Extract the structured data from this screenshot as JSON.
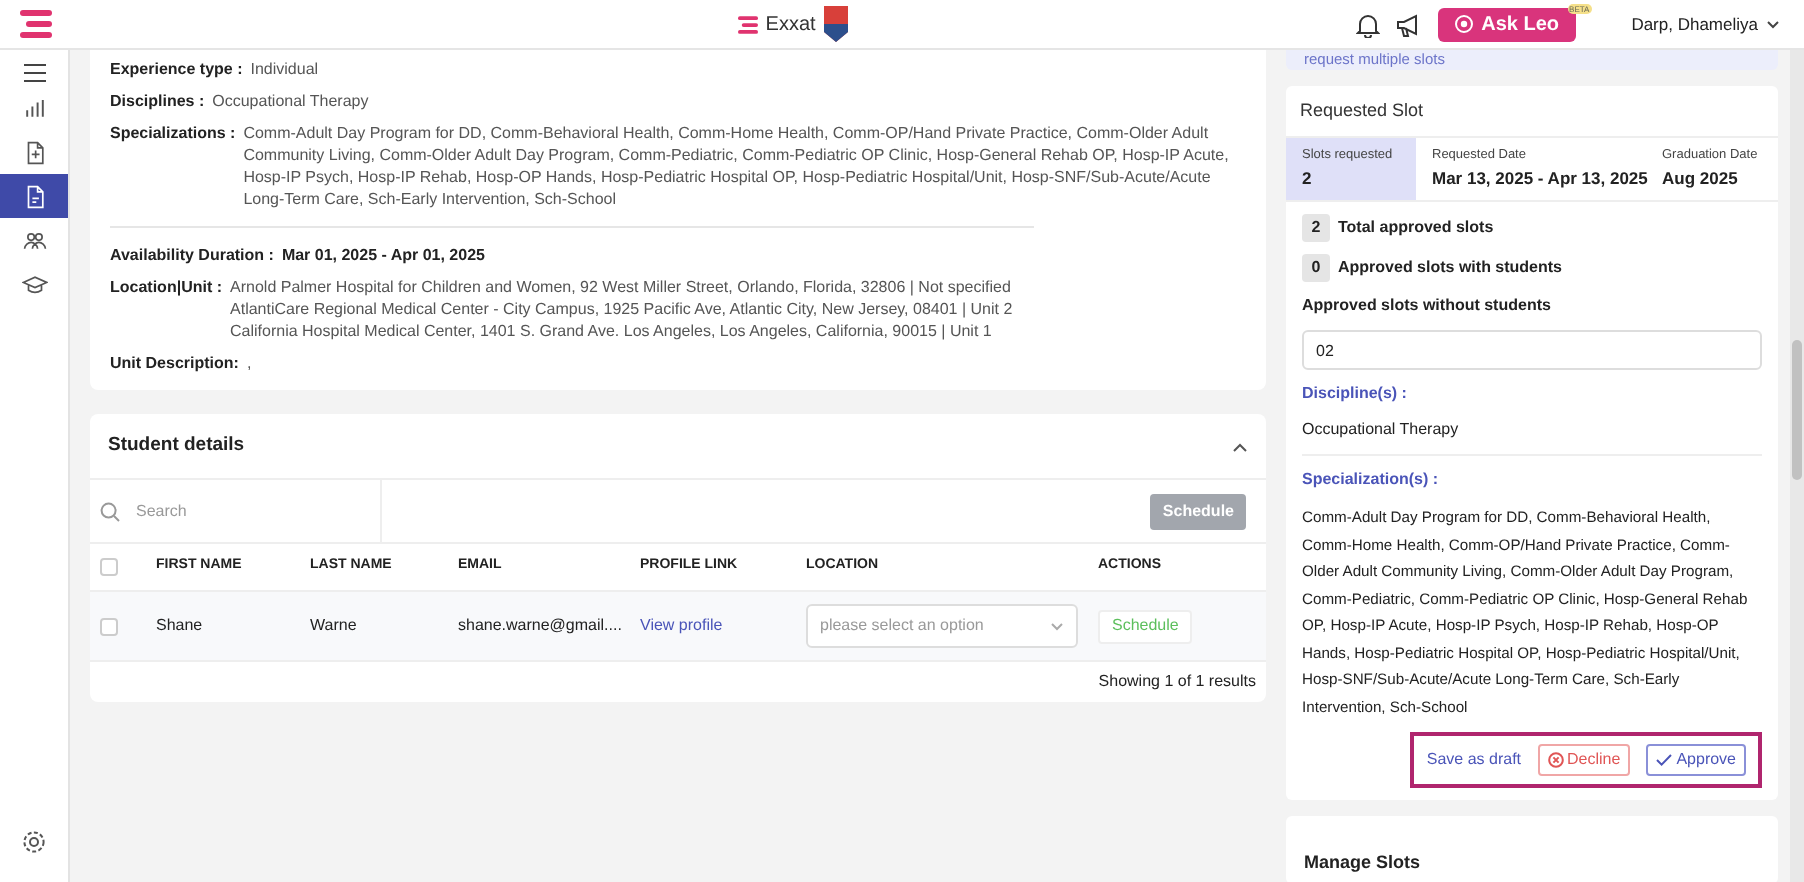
{
  "header": {
    "brand": "Exxat",
    "ask_button": "Ask Leo",
    "ask_badge": "BETA",
    "user": "Darp, Dhameliya"
  },
  "sidebar": {
    "items": [
      {
        "selected": false
      },
      {
        "selected": false
      },
      {
        "selected": true
      },
      {
        "selected": false
      },
      {
        "selected": false
      }
    ]
  },
  "details": {
    "fields": [
      {
        "label": "Experience type :",
        "value": "Individual",
        "bold": false
      },
      {
        "label": "Disciplines :",
        "value": "Occupational Therapy",
        "bold": false
      },
      {
        "label": "Specializations :",
        "value": "Comm-Adult Day Program for DD, Comm-Behavioral Health, Comm-Home Health, Comm-OP/Hand Private Practice, Comm-Older Adult Community Living, Comm-Older Adult Day Program, Comm-Pediatric, Comm-Pediatric OP Clinic, Hosp-General Rehab OP, Hosp-IP Acute, Hosp-IP Psych, Hosp-IP Rehab, Hosp-OP Hands, Hosp-Pediatric Hospital OP, Hosp-Pediatric Hospital/Unit, Hosp-SNF/Sub-Acute/Acute Long-Term Care, Sch-Early Intervention, Sch-School",
        "bold": false,
        "divider_after": true
      },
      {
        "label": "Availability Duration :",
        "value": "Mar 01, 2025 - Apr 01, 2025",
        "bold": true
      },
      {
        "label": "Location|Unit :",
        "lines": [
          "Arnold Palmer Hospital for Children and Women, 92 West Miller Street, Orlando, Florida, 32806 | Not specified",
          "AtlantiCare Regional Medical Center - City Campus, 1925 Pacific Ave, Atlantic City, New Jersey, 08401 | Unit 2",
          "California Hospital Medical Center, 1401 S. Grand Ave. Los Angeles, Los Angeles, California, 90015 | Unit 1"
        ],
        "bold": false
      },
      {
        "label": "Unit Description:",
        "value": ",",
        "bold": false
      }
    ]
  },
  "students": {
    "title": "Student details",
    "all_checked": false,
    "search_placeholder": "Search",
    "schedule_button": "Schedule",
    "columns": [
      "FIRST NAME",
      "LAST NAME",
      "EMAIL",
      "PROFILE LINK",
      "LOCATION",
      "ACTIONS"
    ],
    "rows": [
      {
        "checked": false,
        "first_name": "Shane",
        "last_name": "Warne",
        "email": "shane.warne@gmail....",
        "profile_link": "View profile",
        "location_placeholder": "please select an option",
        "action": "Schedule"
      }
    ],
    "footer": "Showing 1 of 1 results"
  },
  "notice": "request multiple slots",
  "requested_slot": {
    "title": "Requested Slot",
    "stats": [
      {
        "label": "Slots requested",
        "value": "2",
        "selected": true
      },
      {
        "label": "Requested Date",
        "value": "Mar 13, 2025 - Apr 13, 2025",
        "selected": false
      },
      {
        "label": "Graduation Date",
        "value": "Aug 2025",
        "selected": false
      }
    ],
    "counts": [
      {
        "count": "2",
        "label": "Total approved slots"
      },
      {
        "count": "0",
        "label": "Approved slots with students"
      }
    ],
    "without_label": "Approved slots without students",
    "without_value": "02",
    "discipline_label": "Discipline(s) :",
    "discipline": "Occupational Therapy",
    "specialization_label": "Specialization(s) :",
    "specialization": "Comm-Adult Day Program for DD, Comm-Behavioral Health, Comm-Home Health, Comm-OP/Hand Private Practice, Comm-Older Adult Community Living, Comm-Older Adult Day Program, Comm-Pediatric, Comm-Pediatric OP Clinic, Hosp-General Rehab OP, Hosp-IP Acute, Hosp-IP Psych, Hosp-IP Rehab, Hosp-OP Hands, Hosp-Pediatric Hospital OP, Hosp-Pediatric Hospital/Unit, Hosp-SNF/Sub-Acute/Acute Long-Term Care, Sch-Early Intervention, Sch-School",
    "actions": {
      "draft": "Save as draft",
      "decline": "Decline",
      "approve": "Approve",
      "highlighted": true
    }
  },
  "manage": {
    "title": "Manage Slots"
  }
}
